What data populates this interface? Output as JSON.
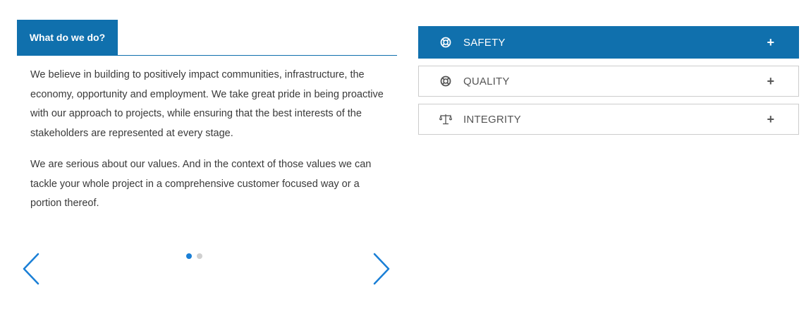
{
  "tabs": {
    "active_label": "What do we do?",
    "paragraphs": [
      "We believe in building to positively impact communities, infrastructure, the economy, opportunity and employment. We take great pride in being proactive with our approach to projects, while ensuring that the best interests of the stakeholders are represented at every stage.",
      "We are serious about our values. And in the context of those values we can tackle your whole project in a comprehensive customer focused way or a portion thereof."
    ]
  },
  "carousel": {
    "prev_icon": "chevron-left-icon",
    "next_icon": "chevron-right-icon",
    "dots_total": 2,
    "active_dot": 1
  },
  "accordion": {
    "items": [
      {
        "title": "SAFETY",
        "icon": "lifebuoy-icon",
        "expanded_marker": "+",
        "active": true
      },
      {
        "title": "QUALITY",
        "icon": "lifebuoy-icon",
        "expanded_marker": "+",
        "active": false
      },
      {
        "title": "INTEGRITY",
        "icon": "scale-icon",
        "expanded_marker": "+",
        "active": false
      }
    ]
  },
  "colors": {
    "accent": "#1070ad",
    "arrow": "#1a7fd6",
    "dot_inactive": "#d0d0d0",
    "border": "#cccccc"
  }
}
